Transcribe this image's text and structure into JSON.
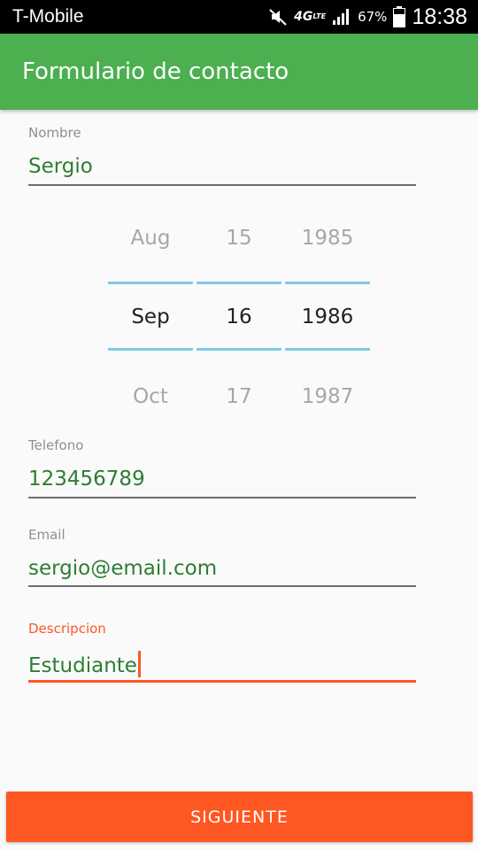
{
  "status_bar": {
    "carrier": "T-Mobile",
    "network": "4G",
    "network_sub": "LTE",
    "battery_percent": "67%",
    "time": "18:38",
    "icons": [
      "mute-icon",
      "signal-icon",
      "battery-icon"
    ]
  },
  "app_bar": {
    "title": "Formulario de contacto",
    "color": "#4caf50"
  },
  "form": {
    "nombre": {
      "label": "Nombre",
      "value": "Sergio"
    },
    "fecha": {
      "month": {
        "prev": "Aug",
        "selected": "Sep",
        "next": "Oct"
      },
      "day": {
        "prev": "15",
        "selected": "16",
        "next": "17"
      },
      "year": {
        "prev": "1985",
        "selected": "1986",
        "next": "1987"
      }
    },
    "telefono": {
      "label": "Telefono",
      "value": "123456789"
    },
    "email": {
      "label": "Email",
      "value": "sergio@email.com"
    },
    "descripcion": {
      "label": "Descripcion",
      "value": "Estudiante",
      "focused": true
    }
  },
  "buttons": {
    "next_label": "SIGUIENTE",
    "accent": "#ff5722"
  },
  "colors": {
    "value_text": "#2e7d32",
    "picker_divider": "#7ecbe6"
  }
}
